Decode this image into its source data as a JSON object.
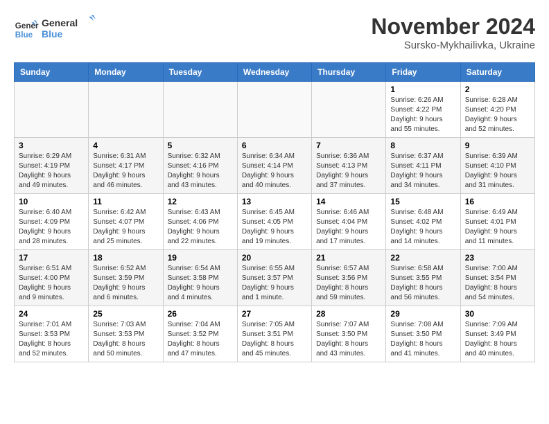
{
  "logo": {
    "line1": "General",
    "line2": "Blue"
  },
  "header": {
    "month": "November 2024",
    "location": "Sursko-Mykhailivka, Ukraine"
  },
  "weekdays": [
    "Sunday",
    "Monday",
    "Tuesday",
    "Wednesday",
    "Thursday",
    "Friday",
    "Saturday"
  ],
  "weeks": [
    [
      {
        "day": "",
        "info": ""
      },
      {
        "day": "",
        "info": ""
      },
      {
        "day": "",
        "info": ""
      },
      {
        "day": "",
        "info": ""
      },
      {
        "day": "",
        "info": ""
      },
      {
        "day": "1",
        "info": "Sunrise: 6:26 AM\nSunset: 4:22 PM\nDaylight: 9 hours and 55 minutes."
      },
      {
        "day": "2",
        "info": "Sunrise: 6:28 AM\nSunset: 4:20 PM\nDaylight: 9 hours and 52 minutes."
      }
    ],
    [
      {
        "day": "3",
        "info": "Sunrise: 6:29 AM\nSunset: 4:19 PM\nDaylight: 9 hours and 49 minutes."
      },
      {
        "day": "4",
        "info": "Sunrise: 6:31 AM\nSunset: 4:17 PM\nDaylight: 9 hours and 46 minutes."
      },
      {
        "day": "5",
        "info": "Sunrise: 6:32 AM\nSunset: 4:16 PM\nDaylight: 9 hours and 43 minutes."
      },
      {
        "day": "6",
        "info": "Sunrise: 6:34 AM\nSunset: 4:14 PM\nDaylight: 9 hours and 40 minutes."
      },
      {
        "day": "7",
        "info": "Sunrise: 6:36 AM\nSunset: 4:13 PM\nDaylight: 9 hours and 37 minutes."
      },
      {
        "day": "8",
        "info": "Sunrise: 6:37 AM\nSunset: 4:11 PM\nDaylight: 9 hours and 34 minutes."
      },
      {
        "day": "9",
        "info": "Sunrise: 6:39 AM\nSunset: 4:10 PM\nDaylight: 9 hours and 31 minutes."
      }
    ],
    [
      {
        "day": "10",
        "info": "Sunrise: 6:40 AM\nSunset: 4:09 PM\nDaylight: 9 hours and 28 minutes."
      },
      {
        "day": "11",
        "info": "Sunrise: 6:42 AM\nSunset: 4:07 PM\nDaylight: 9 hours and 25 minutes."
      },
      {
        "day": "12",
        "info": "Sunrise: 6:43 AM\nSunset: 4:06 PM\nDaylight: 9 hours and 22 minutes."
      },
      {
        "day": "13",
        "info": "Sunrise: 6:45 AM\nSunset: 4:05 PM\nDaylight: 9 hours and 19 minutes."
      },
      {
        "day": "14",
        "info": "Sunrise: 6:46 AM\nSunset: 4:04 PM\nDaylight: 9 hours and 17 minutes."
      },
      {
        "day": "15",
        "info": "Sunrise: 6:48 AM\nSunset: 4:02 PM\nDaylight: 9 hours and 14 minutes."
      },
      {
        "day": "16",
        "info": "Sunrise: 6:49 AM\nSunset: 4:01 PM\nDaylight: 9 hours and 11 minutes."
      }
    ],
    [
      {
        "day": "17",
        "info": "Sunrise: 6:51 AM\nSunset: 4:00 PM\nDaylight: 9 hours and 9 minutes."
      },
      {
        "day": "18",
        "info": "Sunrise: 6:52 AM\nSunset: 3:59 PM\nDaylight: 9 hours and 6 minutes."
      },
      {
        "day": "19",
        "info": "Sunrise: 6:54 AM\nSunset: 3:58 PM\nDaylight: 9 hours and 4 minutes."
      },
      {
        "day": "20",
        "info": "Sunrise: 6:55 AM\nSunset: 3:57 PM\nDaylight: 9 hours and 1 minute."
      },
      {
        "day": "21",
        "info": "Sunrise: 6:57 AM\nSunset: 3:56 PM\nDaylight: 8 hours and 59 minutes."
      },
      {
        "day": "22",
        "info": "Sunrise: 6:58 AM\nSunset: 3:55 PM\nDaylight: 8 hours and 56 minutes."
      },
      {
        "day": "23",
        "info": "Sunrise: 7:00 AM\nSunset: 3:54 PM\nDaylight: 8 hours and 54 minutes."
      }
    ],
    [
      {
        "day": "24",
        "info": "Sunrise: 7:01 AM\nSunset: 3:53 PM\nDaylight: 8 hours and 52 minutes."
      },
      {
        "day": "25",
        "info": "Sunrise: 7:03 AM\nSunset: 3:53 PM\nDaylight: 8 hours and 50 minutes."
      },
      {
        "day": "26",
        "info": "Sunrise: 7:04 AM\nSunset: 3:52 PM\nDaylight: 8 hours and 47 minutes."
      },
      {
        "day": "27",
        "info": "Sunrise: 7:05 AM\nSunset: 3:51 PM\nDaylight: 8 hours and 45 minutes."
      },
      {
        "day": "28",
        "info": "Sunrise: 7:07 AM\nSunset: 3:50 PM\nDaylight: 8 hours and 43 minutes."
      },
      {
        "day": "29",
        "info": "Sunrise: 7:08 AM\nSunset: 3:50 PM\nDaylight: 8 hours and 41 minutes."
      },
      {
        "day": "30",
        "info": "Sunrise: 7:09 AM\nSunset: 3:49 PM\nDaylight: 8 hours and 40 minutes."
      }
    ]
  ]
}
